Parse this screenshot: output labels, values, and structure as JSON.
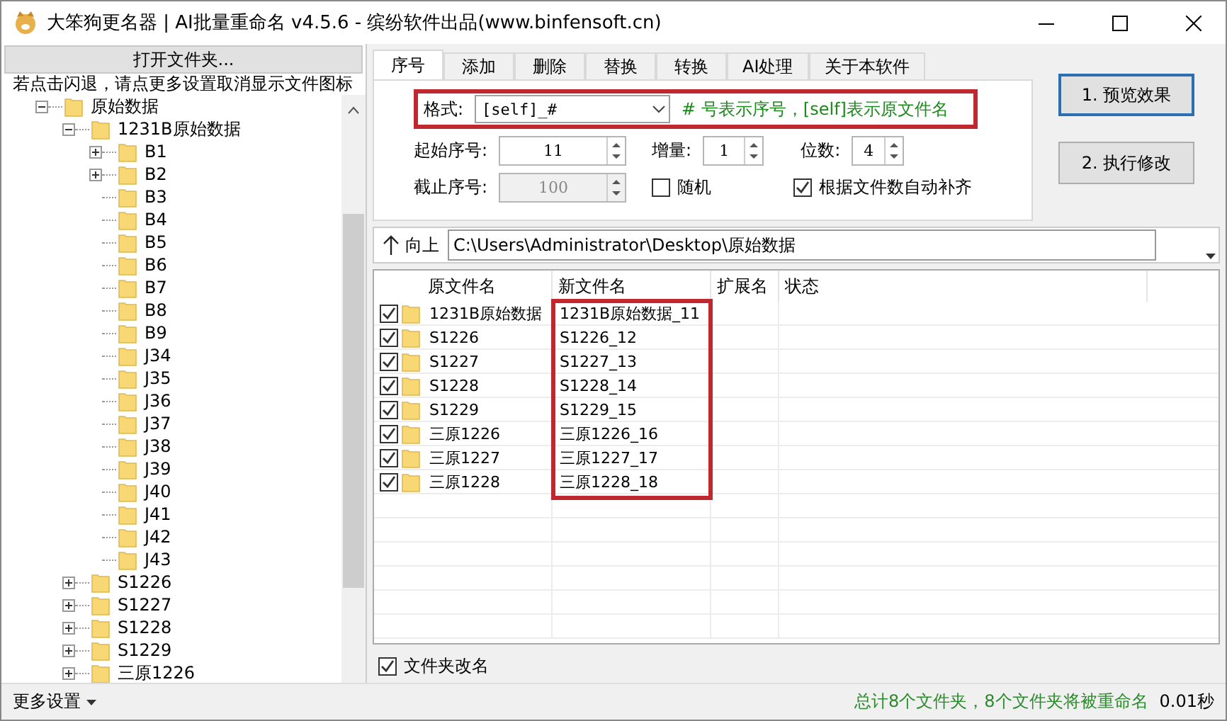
{
  "window": {
    "title": "大笨狗更名器 | AI批量重命名 v4.5.6 - 缤纷软件出品(www.binfensoft.cn)"
  },
  "left_panel": {
    "open_button": "打开文件夹...",
    "hint": "若点击闪退，请点更多设置取消显示文件图标",
    "tree": [
      {
        "label": "原始数据",
        "expanded": true,
        "children": [
          {
            "label": "1231B原始数据",
            "expanded": true,
            "children": [
              {
                "label": "B1",
                "expanded": false
              },
              {
                "label": "B2",
                "expanded": false
              },
              {
                "label": "B3"
              },
              {
                "label": "B4"
              },
              {
                "label": "B5"
              },
              {
                "label": "B6"
              },
              {
                "label": "B7"
              },
              {
                "label": "B8"
              },
              {
                "label": "B9"
              },
              {
                "label": "J34"
              },
              {
                "label": "J35"
              },
              {
                "label": "J36"
              },
              {
                "label": "J37"
              },
              {
                "label": "J38"
              },
              {
                "label": "J39"
              },
              {
                "label": "J40"
              },
              {
                "label": "J41"
              },
              {
                "label": "J42"
              },
              {
                "label": "J43"
              }
            ]
          },
          {
            "label": "S1226",
            "expanded": false
          },
          {
            "label": "S1227",
            "expanded": false
          },
          {
            "label": "S1228",
            "expanded": false
          },
          {
            "label": "S1229",
            "expanded": false
          },
          {
            "label": "三原1226",
            "expanded": false
          }
        ]
      }
    ]
  },
  "tabs": [
    {
      "label": "序号",
      "selected": true
    },
    {
      "label": "添加",
      "selected": false
    },
    {
      "label": "删除",
      "selected": false
    },
    {
      "label": "替换",
      "selected": false
    },
    {
      "label": "转换",
      "selected": false
    },
    {
      "label": "AI处理",
      "selected": false
    },
    {
      "label": "关于本软件",
      "selected": false
    }
  ],
  "format": {
    "label": "格式:",
    "value": "[self]_#",
    "hint": "# 号表示序号，[self]表示原文件名"
  },
  "spinners": [
    {
      "label": "起始序号:",
      "value": "11",
      "disabled": false
    },
    {
      "label": "增量:",
      "value": "1",
      "disabled": false
    },
    {
      "label": "位数:",
      "value": "4",
      "disabled": false
    },
    {
      "label": "截止序号:",
      "value": "100",
      "disabled": true
    }
  ],
  "checkboxes": [
    {
      "label": "随机",
      "checked": false
    },
    {
      "label": "根据文件数自动补齐",
      "checked": true
    }
  ],
  "actions": [
    {
      "label": "1. 预览效果",
      "focused": true
    },
    {
      "label": "2. 执行修改",
      "focused": false
    }
  ],
  "path_bar": {
    "up_button": "向上",
    "path": "C:\\Users\\Administrator\\Desktop\\原始数据"
  },
  "table": {
    "columns": [
      "原文件名",
      "新文件名",
      "扩展名",
      "状态"
    ],
    "rows": [
      {
        "checked": true,
        "original": "1231B原始数据",
        "new_name": "1231B原始数据_11"
      },
      {
        "checked": true,
        "original": "S1226",
        "new_name": "S1226_12"
      },
      {
        "checked": true,
        "original": "S1227",
        "new_name": "S1227_13"
      },
      {
        "checked": true,
        "original": "S1228",
        "new_name": "S1228_14"
      },
      {
        "checked": true,
        "original": "S1229",
        "new_name": "S1229_15"
      },
      {
        "checked": true,
        "original": "三原1226",
        "new_name": "三原1226_16"
      },
      {
        "checked": true,
        "original": "三原1227",
        "new_name": "三原1227_17"
      },
      {
        "checked": true,
        "original": "三原1228",
        "new_name": "三原1228_18"
      }
    ]
  },
  "folder_rename": {
    "label": "文件夹改名",
    "checked": true
  },
  "status_bar": {
    "menu": "更多设置",
    "summary": "总计8个文件夹，8个文件夹将被重命名",
    "time": "0.01秒"
  }
}
